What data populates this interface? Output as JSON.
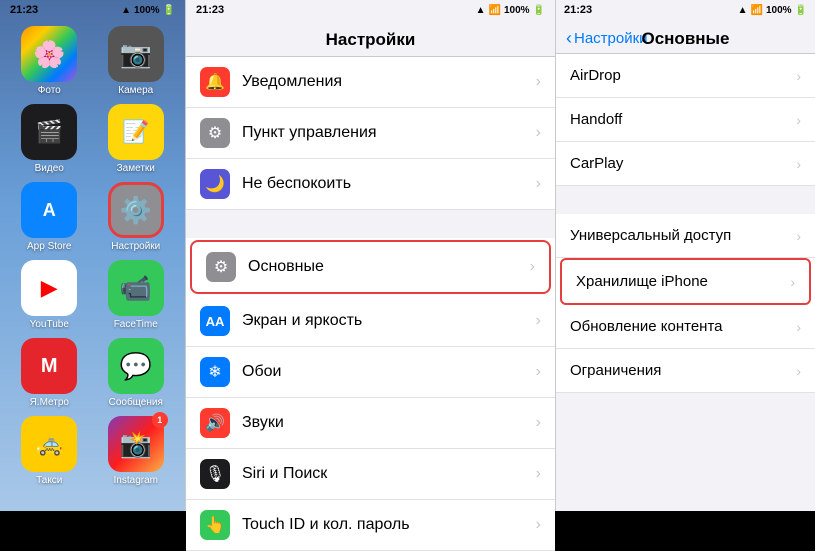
{
  "left_panel": {
    "status_bar": {
      "time": "21:23",
      "battery": "100%"
    },
    "apps": [
      {
        "id": "photos",
        "label": "Фото",
        "emoji": "🖼",
        "bg": "#f0a030",
        "badge": null
      },
      {
        "id": "camera",
        "label": "Камера",
        "emoji": "📷",
        "bg": "#888",
        "badge": null
      },
      {
        "id": "video",
        "label": "Видео",
        "emoji": "🎬",
        "bg": "#1c1c1c",
        "badge": null
      },
      {
        "id": "notes",
        "label": "Заметки",
        "emoji": "📝",
        "bg": "#ffd60a",
        "badge": null
      },
      {
        "id": "appstore",
        "label": "App Store",
        "emoji": "🅰",
        "bg": "#0a84ff",
        "badge": null
      },
      {
        "id": "settings",
        "label": "Настройки",
        "emoji": "⚙",
        "bg": "#8e8e93",
        "badge": null,
        "highlight": true
      },
      {
        "id": "youtube",
        "label": "YouTube",
        "emoji": "▶",
        "bg": "#ff0000",
        "badge": null
      },
      {
        "id": "facetime",
        "label": "FaceTime",
        "emoji": "📹",
        "bg": "#34c759",
        "badge": null
      },
      {
        "id": "metro",
        "label": "Я.Метро",
        "emoji": "М",
        "bg": "#e4262c",
        "badge": null
      },
      {
        "id": "messages",
        "label": "Сообщения",
        "emoji": "💬",
        "bg": "#34c759",
        "badge": null
      },
      {
        "id": "taxi",
        "label": "Такси",
        "emoji": "🚕",
        "bg": "#fc0",
        "badge": null
      },
      {
        "id": "instagram",
        "label": "Instagram",
        "emoji": "📸",
        "bg": "#c13584",
        "badge": "1"
      }
    ]
  },
  "middle_panel": {
    "status_bar": {
      "time": "21:23",
      "battery": "100%"
    },
    "title": "Настройки",
    "items": [
      {
        "id": "notifications",
        "label": "Уведомления",
        "icon_bg": "#ff3b30",
        "icon": "🔔"
      },
      {
        "id": "control_center",
        "label": "Пункт управления",
        "icon_bg": "#8e8e93",
        "icon": "⚙"
      },
      {
        "id": "do_not_disturb",
        "label": "Не беспокоить",
        "icon_bg": "#5856d6",
        "icon": "🌙"
      },
      {
        "id": "general",
        "label": "Основные",
        "icon_bg": "#8e8e93",
        "icon": "⚙",
        "highlight": true
      },
      {
        "id": "display",
        "label": "Экран и яркость",
        "icon_bg": "#007aff",
        "icon": "AA"
      },
      {
        "id": "wallpaper",
        "label": "Обои",
        "icon_bg": "#007aff",
        "icon": "❄"
      },
      {
        "id": "sounds",
        "label": "Звуки",
        "icon_bg": "#ff3b30",
        "icon": "🔊"
      },
      {
        "id": "siri",
        "label": "Siri и Поиск",
        "icon_bg": "#000",
        "icon": "🎙"
      },
      {
        "id": "touchid",
        "label": "Touch ID и кол. пароль",
        "icon_bg": "#34c759",
        "icon": "👆"
      }
    ]
  },
  "right_panel": {
    "status_bar": {
      "time": "21:23",
      "battery": "100%"
    },
    "back_label": "Настройки",
    "title": "Основные",
    "items_top": [
      {
        "id": "airdrop",
        "label": "AirDrop"
      },
      {
        "id": "handoff",
        "label": "Handoff"
      },
      {
        "id": "carplay",
        "label": "CarPlay"
      }
    ],
    "items_bottom": [
      {
        "id": "accessibility",
        "label": "Универсальный доступ"
      },
      {
        "id": "storage",
        "label": "Хранилище iPhone",
        "highlight": true
      },
      {
        "id": "content_update",
        "label": "Обновление контента"
      },
      {
        "id": "restrictions",
        "label": "Ограничения"
      }
    ]
  }
}
